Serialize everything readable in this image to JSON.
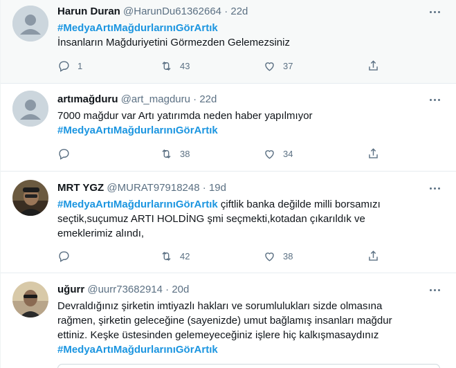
{
  "tweets": [
    {
      "name": "Harun Duran",
      "handle": "@HarunDu61362664",
      "sep": "·",
      "time": "22d",
      "line1_hashtag": "#MedyaArtıMağdurlarınıGörArtık",
      "line2_text": "İnsanların Mağduriyetini Görmezden Gelemezsiniz",
      "reply_count": "1",
      "retweet_count": "43",
      "like_count": "37"
    },
    {
      "name": "artımağduru",
      "handle": "@art_magduru",
      "sep": "·",
      "time": "22d",
      "line1_text": "7000 mağdur var Artı yatırımda neden haber yapılmıyor",
      "line2_hashtag": "#MedyaArtıMağdurlarınıGörArtık",
      "reply_count": "",
      "retweet_count": "38",
      "like_count": "34"
    },
    {
      "name": "MRT YGZ",
      "handle": "@MURAT97918248",
      "sep": "·",
      "time": "19d",
      "line1_hashtag": "#MedyaArtıMağdurlarınıGörArtık",
      "line1_text": " çiftlik banka değilde milli borsamızı",
      "line2_text": "seçtik,suçumuz ARTI HOLDİNG şmi seçmekti,kotadan çıkarıldık ve",
      "line3_text": "emeklerimiz alındı,",
      "reply_count": "",
      "retweet_count": "42",
      "like_count": "38"
    },
    {
      "name": "uğurr",
      "handle": "@uurr73682914",
      "sep": "·",
      "time": "20d",
      "line1_text": "Devraldığınız şirketin imtiyazlı hakları ve sorumlulukları sizde olmasına",
      "line2_text": "rağmen, şirketin geleceğine (sayenizde) umut bağlamış insanları mağdur",
      "line3_text": "ettiniz. Keşke üstesinden gelemeyeceğiniz işlere hiç kalkışmasaydınız",
      "line4_hashtag": "#MedyaArtıMağdurlarınıGörArtık"
    }
  ],
  "icons": {
    "reply": "reply-icon",
    "retweet": "retweet-icon",
    "like": "heart-icon",
    "share": "share-icon",
    "more": "more-icon"
  },
  "colors": {
    "hashtag": "#1b95e0",
    "secondary": "#5b7083",
    "hover_bg": "#f7f9f9"
  }
}
